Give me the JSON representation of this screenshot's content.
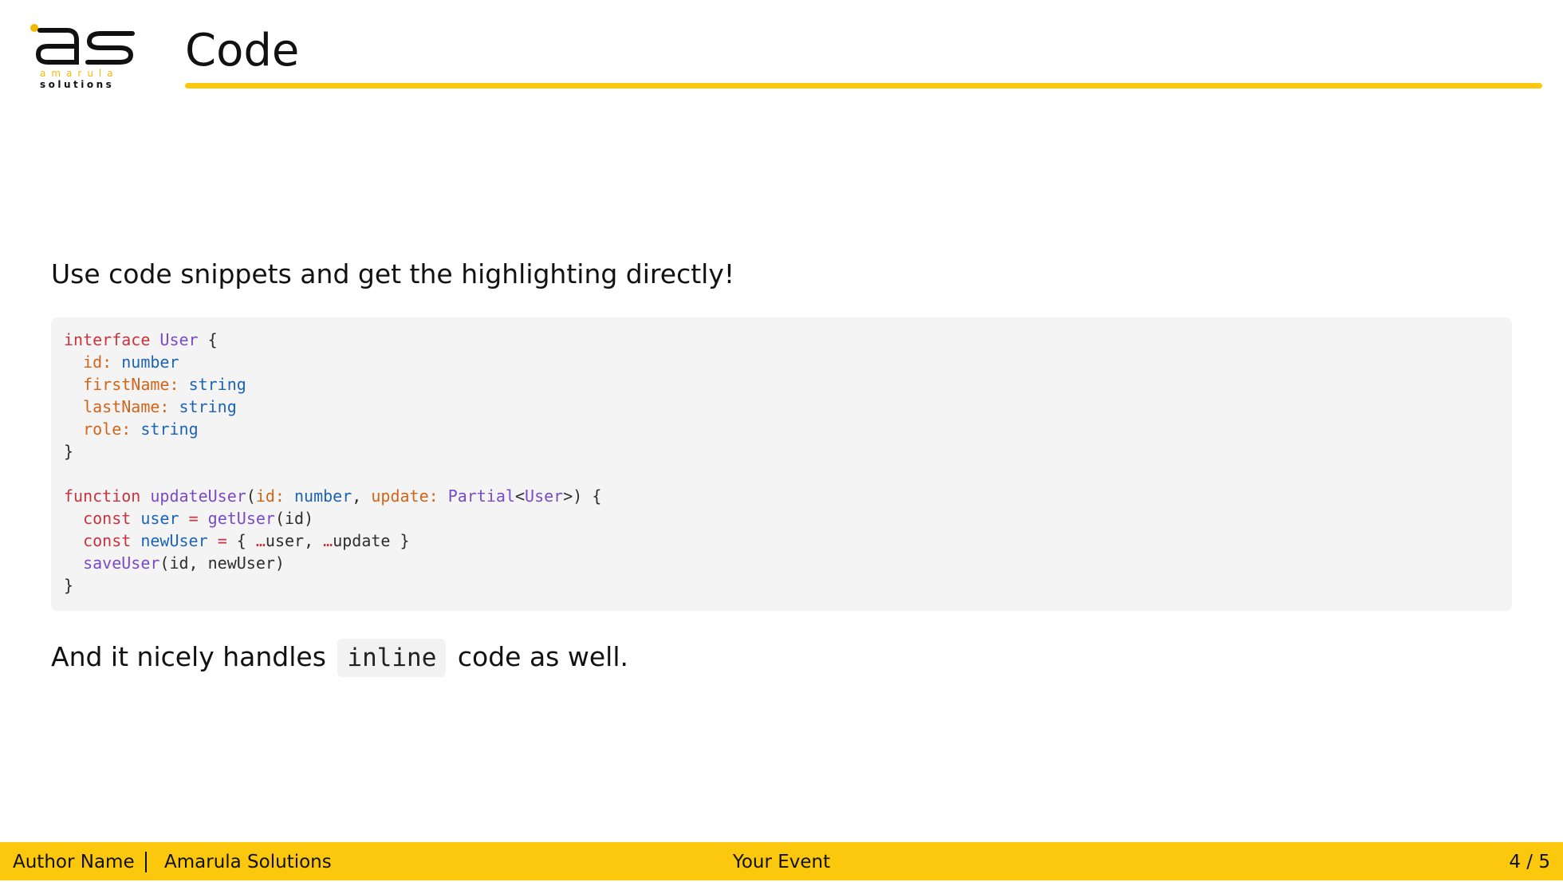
{
  "logo": {
    "mark": "as",
    "line1": "amarula",
    "line2": "solutions",
    "colors": {
      "accent": "#f5b800",
      "ink": "#111111"
    }
  },
  "header": {
    "title": "Code"
  },
  "content": {
    "intro": "Use code snippets and get the highlighting directly!",
    "code_lines": [
      [
        {
          "t": "interface ",
          "c": "kw"
        },
        {
          "t": "User",
          "c": "ty"
        },
        {
          "t": " {",
          "c": ""
        }
      ],
      [
        {
          "t": "  ",
          "c": ""
        },
        {
          "t": "id:",
          "c": "prop"
        },
        {
          "t": " ",
          "c": ""
        },
        {
          "t": "number",
          "c": "bt"
        }
      ],
      [
        {
          "t": "  ",
          "c": ""
        },
        {
          "t": "firstName:",
          "c": "prop"
        },
        {
          "t": " ",
          "c": ""
        },
        {
          "t": "string",
          "c": "bt"
        }
      ],
      [
        {
          "t": "  ",
          "c": ""
        },
        {
          "t": "lastName:",
          "c": "prop"
        },
        {
          "t": " ",
          "c": ""
        },
        {
          "t": "string",
          "c": "bt"
        }
      ],
      [
        {
          "t": "  ",
          "c": ""
        },
        {
          "t": "role:",
          "c": "prop"
        },
        {
          "t": " ",
          "c": ""
        },
        {
          "t": "string",
          "c": "bt"
        }
      ],
      [
        {
          "t": "}",
          "c": ""
        }
      ],
      [],
      [
        {
          "t": "function ",
          "c": "kw"
        },
        {
          "t": "updateUser",
          "c": "fn"
        },
        {
          "t": "(",
          "c": ""
        },
        {
          "t": "id:",
          "c": "prop"
        },
        {
          "t": " ",
          "c": ""
        },
        {
          "t": "number",
          "c": "bt"
        },
        {
          "t": ", ",
          "c": ""
        },
        {
          "t": "update:",
          "c": "prop"
        },
        {
          "t": " ",
          "c": ""
        },
        {
          "t": "Partial",
          "c": "ty"
        },
        {
          "t": "<",
          "c": ""
        },
        {
          "t": "User",
          "c": "ty"
        },
        {
          "t": ">) {",
          "c": ""
        }
      ],
      [
        {
          "t": "  ",
          "c": ""
        },
        {
          "t": "const ",
          "c": "kw"
        },
        {
          "t": "user",
          "c": "var"
        },
        {
          "t": " ",
          "c": ""
        },
        {
          "t": "=",
          "c": "op"
        },
        {
          "t": " ",
          "c": ""
        },
        {
          "t": "getUser",
          "c": "fn"
        },
        {
          "t": "(id)",
          "c": ""
        }
      ],
      [
        {
          "t": "  ",
          "c": ""
        },
        {
          "t": "const ",
          "c": "kw"
        },
        {
          "t": "newUser",
          "c": "var"
        },
        {
          "t": " ",
          "c": ""
        },
        {
          "t": "=",
          "c": "op"
        },
        {
          "t": " { ",
          "c": ""
        },
        {
          "t": "…",
          "c": "op"
        },
        {
          "t": "user, ",
          "c": ""
        },
        {
          "t": "…",
          "c": "op"
        },
        {
          "t": "update }",
          "c": ""
        }
      ],
      [
        {
          "t": "  ",
          "c": ""
        },
        {
          "t": "saveUser",
          "c": "fn"
        },
        {
          "t": "(id, newUser)",
          "c": ""
        }
      ],
      [
        {
          "t": "}",
          "c": ""
        }
      ]
    ],
    "code_colors": {
      "keyword": "#c6343f",
      "type": "#7a4bc3",
      "property": "#d1651a",
      "builtin": "#1c64b4"
    },
    "outro_before": "And it nicely handles",
    "outro_code": "inline",
    "outro_after": "code as well."
  },
  "footer": {
    "author": "Author Name",
    "organization": "Amarula Solutions",
    "event": "Your Event",
    "page": "4 / 5",
    "background": "#fcc80d"
  }
}
